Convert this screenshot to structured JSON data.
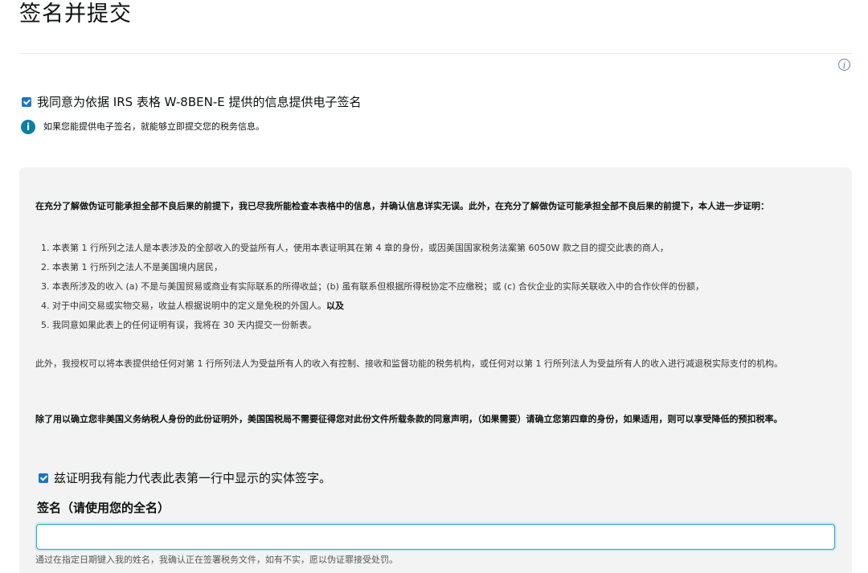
{
  "page": {
    "title": "签名并提交",
    "info_icon": "info-circle-icon"
  },
  "esign": {
    "consent_checked": true,
    "consent_label": "我同意为依据 IRS 表格 W-8BEN-E 提供的信息提供电子签名",
    "alert_icon": "info-filled-icon",
    "alert_text": "如果您能提供电子签名，就能够立即提交您的税务信息。"
  },
  "certification": {
    "intro": "在充分了解做伪证可能承担全部不良后果的前提下，我已尽我所能检查本表格中的信息，并确认信息详实无误。此外，在充分了解做伪证可能承担全部不良后果的前提下，本人进一步证明：",
    "items": [
      "1. 本表第 1 行所列之法人是本表涉及的全部收入的受益所有人，使用本表证明其在第 4 章的身份，或因美国国家税务法案第 6050W 款之目的提交此表的商人，",
      "2. 本表第 1 行所列之法人不是美国境内居民，",
      "3. 本表所涉及的收入 (a) 不是与美国贸易或商业有实际联系的所得收益；(b) 虽有联系但根据所得税协定不应缴税；或 (c) 合伙企业的实际关联收入中的合作伙伴的份额，",
      "4. 对于中间交易或实物交易，收益人根据说明中的定义是免税的外国人。",
      "5. 我同意如果此表上的任何证明有误，我将在 30 天内提交一份新表。"
    ],
    "item4_suffix": "以及",
    "authorization": "此外，我授权可以将本表提供给任何对第 1 行所列法人为受益所有人的收入有控制、接收和监督功能的税务机构，或任何对以第 1 行所列法人为受益所有人的收入进行减退税实际支付的机构。",
    "irs_notice": "除了用以确立您非美国义务纳税人身份的此份证明外，美国国税局不需要征得您对此份文件所载条款的同意声明，（如果需要）请确立您第四章的身份，如果适用，则可以享受降低的预扣税率。",
    "capacity_checked": true,
    "capacity_label": "兹证明我有能力代表此表第一行中显示的实体签字。"
  },
  "signature": {
    "label": "签名（请使用您的全名）",
    "value": "",
    "placeholder": "",
    "hint": "通过在指定日期键入我的姓名，我确认正在签署税务文件，如有不实，愿以伪证罪接受处罚。"
  },
  "colors": {
    "checkbox": "#1a73c9",
    "alert_icon": "#0d7ea4",
    "panel_bg": "#f3f3f3",
    "input_focus_border": "#2ca6b8"
  }
}
